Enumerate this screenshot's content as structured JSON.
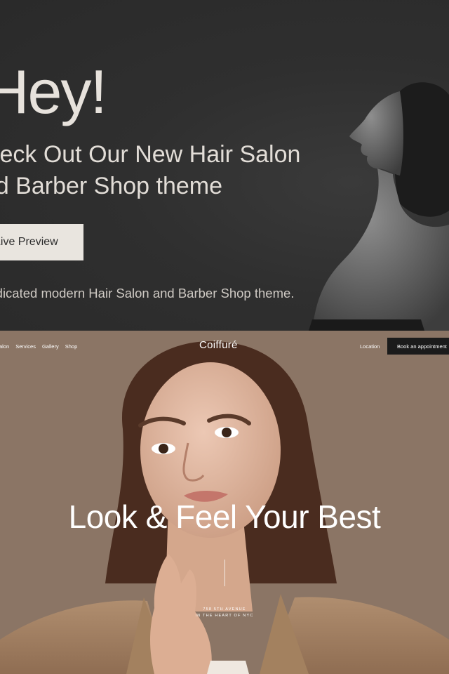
{
  "promo": {
    "greeting": "Hey!",
    "headline_line1": "Check Out Our New Hair Salon",
    "headline_line2": "and Barber Shop theme",
    "button_label": "Live Preview",
    "description": "Dedicated modern Hair Salon and Barber Shop theme."
  },
  "site": {
    "nav": [
      {
        "label": "Salon"
      },
      {
        "label": "Services"
      },
      {
        "label": "Gallery"
      },
      {
        "label": "Shop"
      }
    ],
    "logo": "Coiffuré",
    "location_label": "Location",
    "book_label": "Book an appointment",
    "hero_title": "Look & Feel Your Best",
    "address_line1": "758 5TH AVENUE",
    "address_line2": "IN THE HEART OF NYC"
  },
  "colors": {
    "promo_bg": "#2c2c2c",
    "site_bg": "#8b7565",
    "button_light": "#e9e5df",
    "button_dark": "#1b1b1b"
  }
}
